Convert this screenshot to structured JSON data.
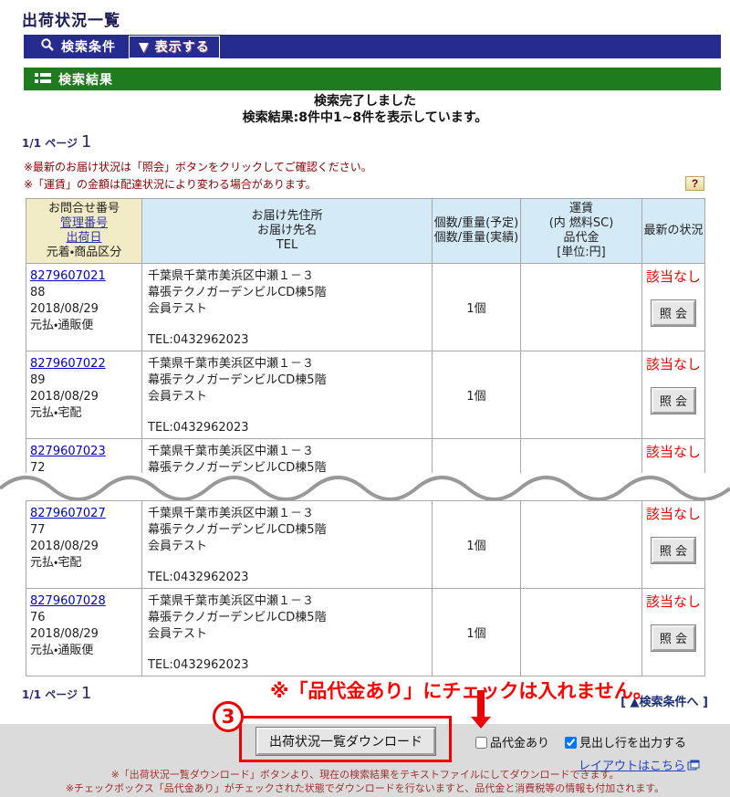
{
  "page": {
    "title": "出荷状況一覧"
  },
  "bars": {
    "search_conditions_label": "検索条件",
    "show_button_label": "▼ 表示する",
    "search_results_label": "検索結果"
  },
  "status": {
    "line1": "検索完了しました",
    "line2": "検索結果:8件中1~8件を表示しています。"
  },
  "pagination": {
    "label": "1/1 ページ",
    "page": "1"
  },
  "notes": {
    "note1": "※最新のお届け状況は「照会」ボタンをクリックしてご確認ください。",
    "note2": "※「運賃」の金額は配達状況により変わる場合があります。",
    "help": "?"
  },
  "table": {
    "headers": {
      "c1_line1": "お問合せ番号",
      "c1_link1": "管理番号",
      "c1_link2": "出荷日",
      "c1_line4": "元着・商品区分",
      "c2_line1": "お届け先住所",
      "c2_line2": "お届け先名",
      "c2_line3": "TEL",
      "c3_line1": "個数/重量(予定)",
      "c3_line2": "個数/重量(実績)",
      "c4_line1": "運賃",
      "c4_line2": "(内 燃料SC)",
      "c4_line3": "品代金",
      "c4_line4": "[単位:円]",
      "c5": "最新の状況"
    },
    "rows": [
      {
        "tracking": "8279607021",
        "mgmt": "88",
        "date": "2018/08/29",
        "category": "元払・通販便",
        "addr1": "千葉県千葉市美浜区中瀬１－３",
        "addr2": "幕張テクノガーデンビルCD棟5階",
        "name": "会員テスト",
        "tel": "TEL:0432962023",
        "qty": "1個",
        "fare": "",
        "status": "該当なし",
        "action": "照 会"
      },
      {
        "tracking": "8279607022",
        "mgmt": "89",
        "date": "2018/08/29",
        "category": "元払・宅配",
        "addr1": "千葉県千葉市美浜区中瀬１－３",
        "addr2": "幕張テクノガーデンビルCD棟5階",
        "name": "会員テスト",
        "tel": "TEL:0432962023",
        "qty": "1個",
        "fare": "",
        "status": "該当なし",
        "action": "照 会"
      },
      {
        "tracking": "8279607023",
        "mgmt": "72",
        "date": "",
        "category": "",
        "addr1": "千葉県千葉市美浜区中瀬１－３",
        "addr2": "幕張テクノガーデンビルCD棟5階",
        "name": "",
        "tel": "",
        "qty": "",
        "fare": "",
        "status": "該当なし",
        "action": ""
      },
      {
        "tracking": "8279607027",
        "mgmt": "77",
        "date": "2018/08/29",
        "category": "元払・宅配",
        "addr1": "千葉県千葉市美浜区中瀬１－３",
        "addr2": "幕張テクノガーデンビルCD棟5階",
        "name": "会員テスト",
        "tel": "TEL:0432962023",
        "qty": "1個",
        "fare": "",
        "status": "該当なし",
        "action": "照 会"
      },
      {
        "tracking": "8279607028",
        "mgmt": "76",
        "date": "2018/08/29",
        "category": "元払・通販便",
        "addr1": "千葉県千葉市美浜区中瀬１－３",
        "addr2": "幕張テクノガーデンビルCD棟5階",
        "name": "会員テスト",
        "tel": "TEL:0432962023",
        "qty": "1個",
        "fare": "",
        "status": "該当なし",
        "action": "照 会"
      }
    ]
  },
  "annotation": {
    "red_text": "※「品代金あり」にチェックは入れません。",
    "step_number": "3"
  },
  "bottom": {
    "back_link": "[ ▲検索条件へ ]",
    "download_button": "出荷状況一覧ダウンロード",
    "checkbox_codamount": "品代金あり",
    "checkbox_header": "見出し行を出力する",
    "layout_link": "レイアウトはこちら",
    "note1": "※「出荷状況一覧ダウンロード」ボタンより、現在の検索結果をテキストファイルにしてダウンロードできます。",
    "note2": "※チェックボックス「品代金あり」がチェックされた状態でダウンロードを行ないますと、品代金と消費税等の情報も付加されます。"
  },
  "colors": {
    "bar_blue": "#262b8f",
    "bar_green": "#1e7c1e",
    "header_cream": "#f2ecc6",
    "header_lightblue": "#d4eaf7",
    "status_red": "#ff0000",
    "note_darkred": "#8b0000",
    "annotation_red": "#ee0000"
  }
}
